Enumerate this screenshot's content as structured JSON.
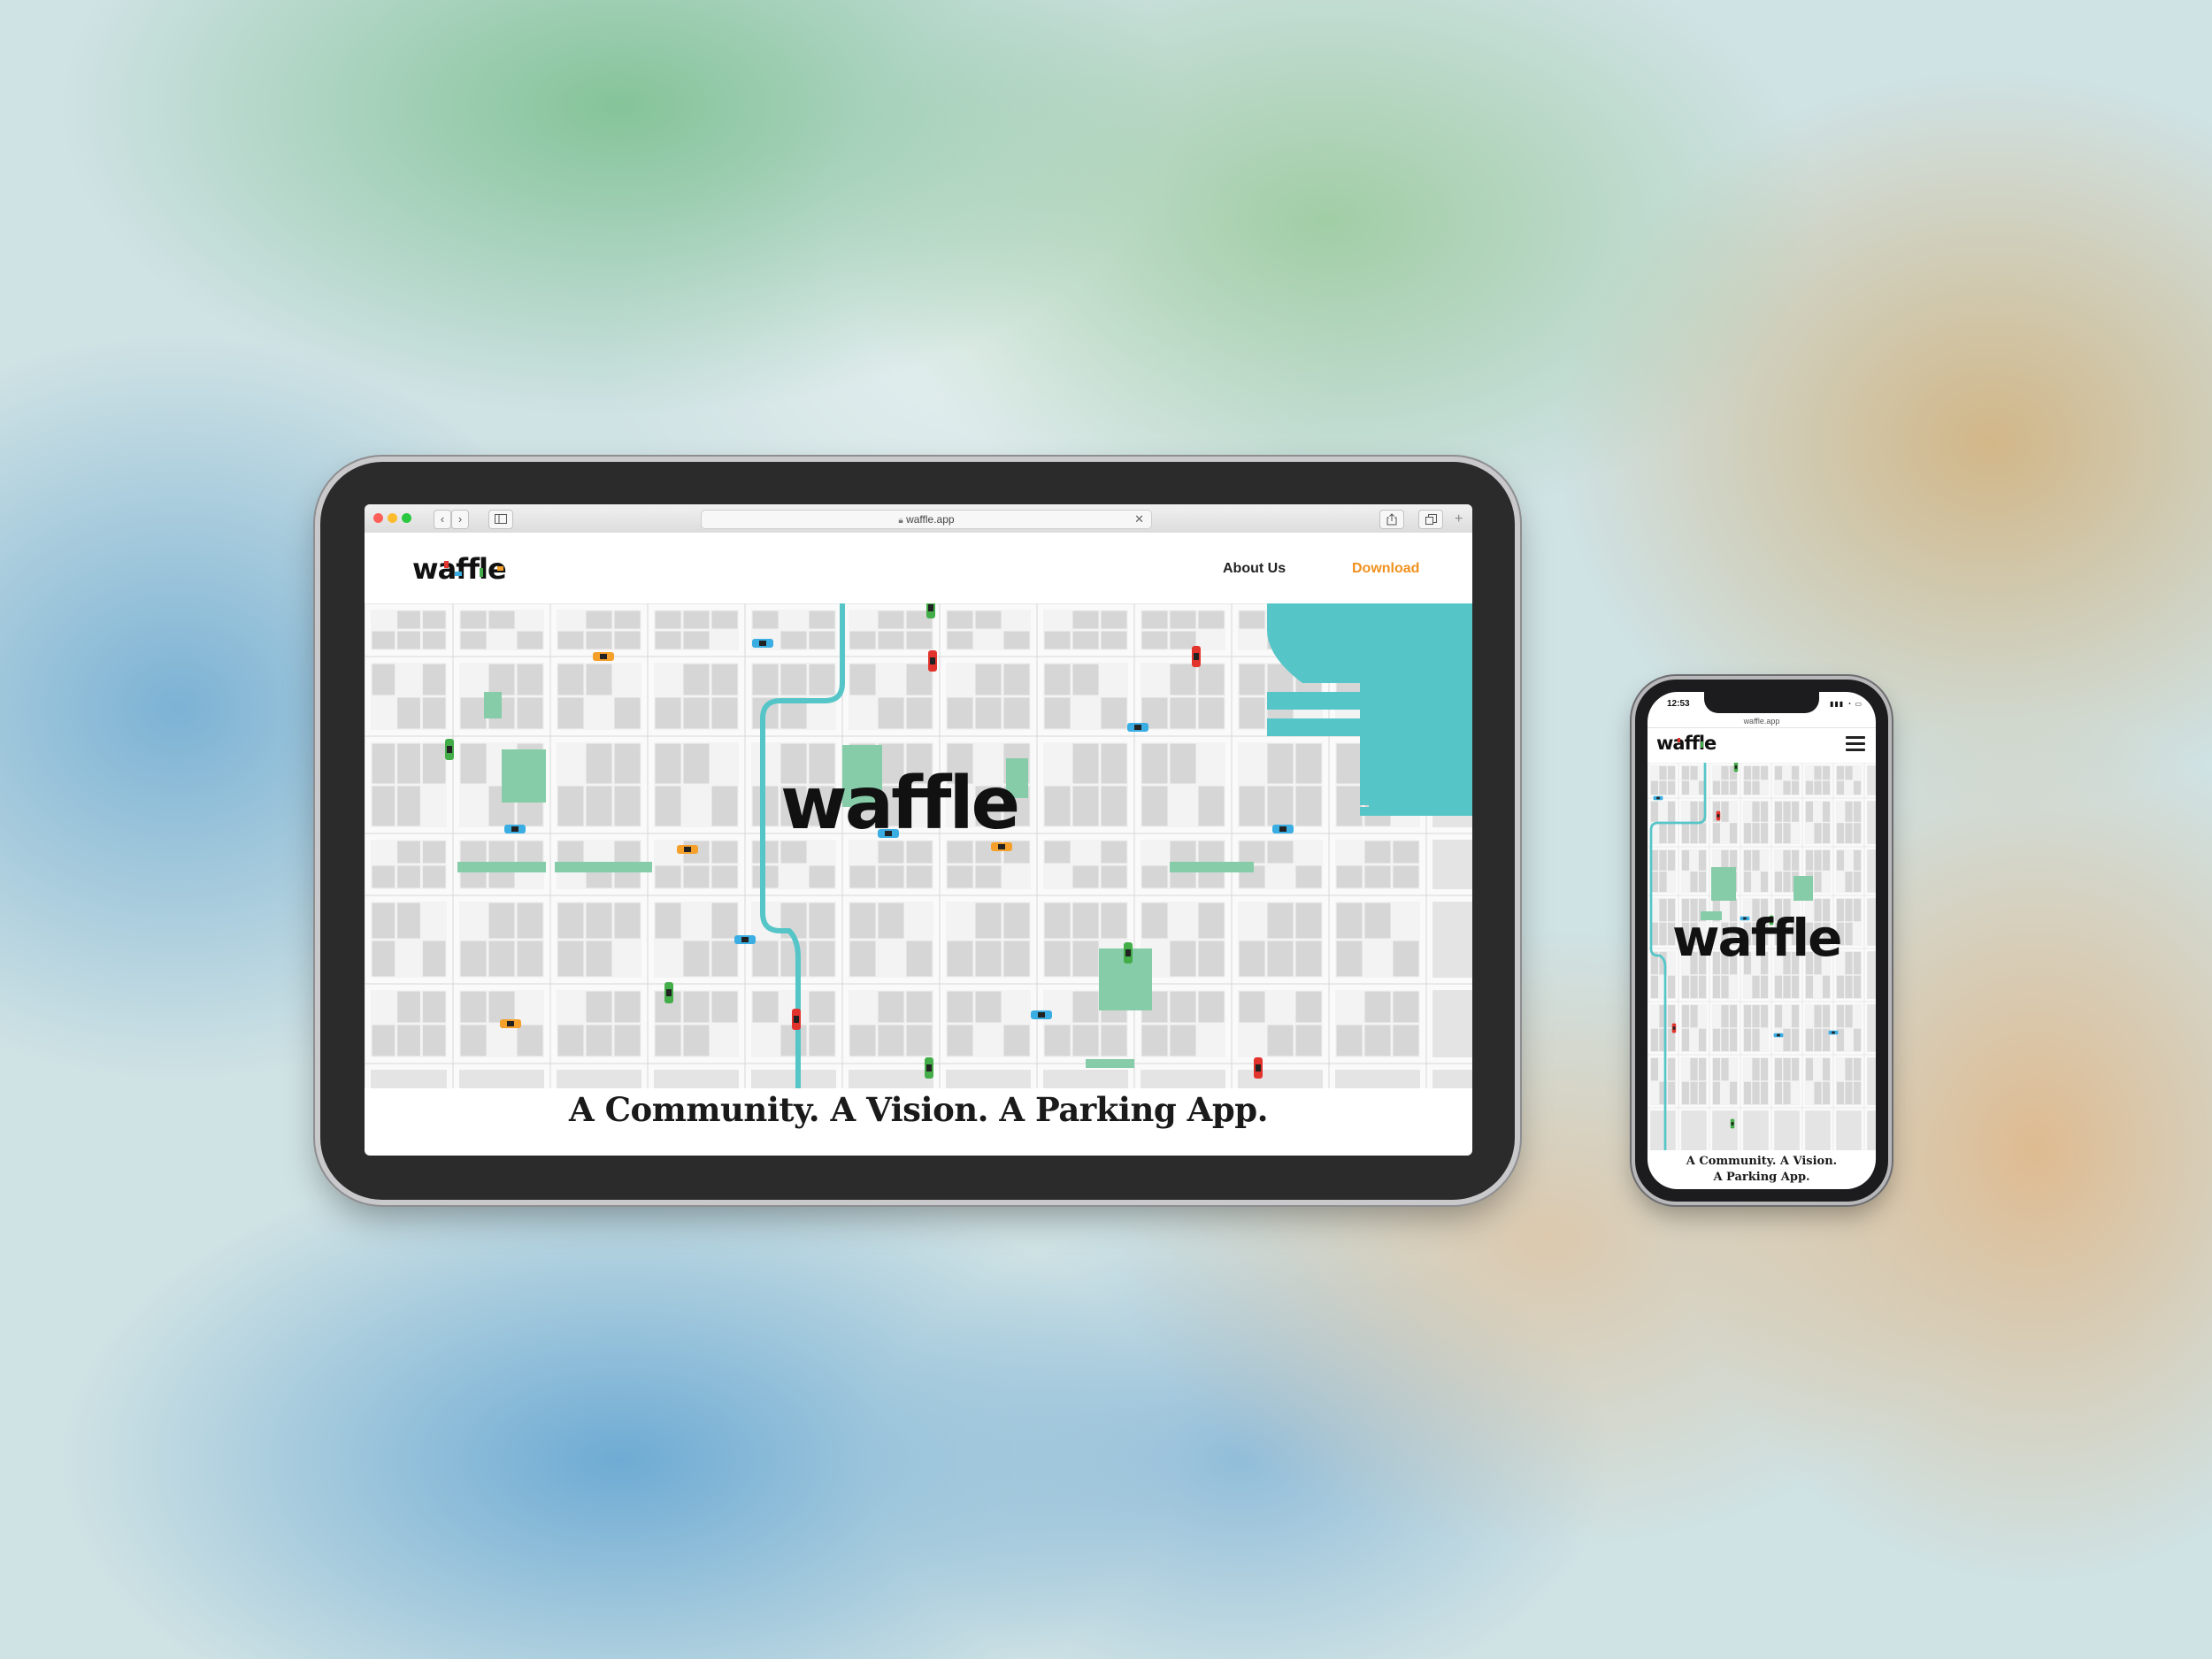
{
  "browser": {
    "url": "waffle.app"
  },
  "site": {
    "logo": "waffle",
    "nav": {
      "about": "About Us",
      "download": "Download"
    },
    "hero_logo": "waffle",
    "tagline": "A Community. A Vision. A Parking App."
  },
  "phone": {
    "time": "12:53",
    "url": "waffle.app",
    "logo": "waffle",
    "hero_logo": "waffle",
    "tagline_line1": "A Community. A Vision.",
    "tagline_line2": "A Parking App."
  },
  "colors": {
    "accent_orange": "#f0901e",
    "water": "#56c5c8",
    "park": "#86cca9",
    "road": "#f2f2f2",
    "block": "#d4d4d4",
    "car_red": "#e2342d",
    "car_blue": "#3aaee3",
    "car_green": "#43ad49",
    "car_orange": "#f5a02a"
  },
  "icons": {
    "back": "chevron-left-icon",
    "forward": "chevron-right-icon",
    "sidebar": "sidebar-icon",
    "lock": "lock-icon",
    "share": "share-icon",
    "tabs": "tabs-icon",
    "menu": "hamburger-menu-icon"
  }
}
